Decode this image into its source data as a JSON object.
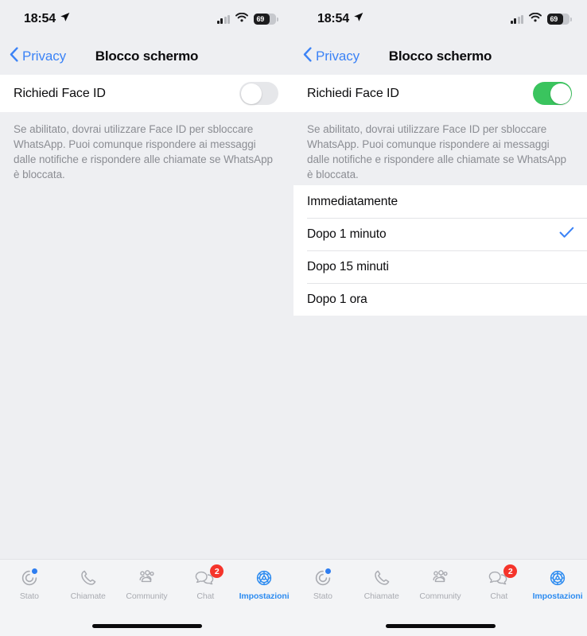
{
  "meta": {
    "app": "WhatsApp",
    "platform": "iOS",
    "accent_blue": "#3c83f6",
    "accent_green": "#3ac45e",
    "badge_red": "#f5342b",
    "background_gray": "#eeeff2",
    "card_white": "#ffffff",
    "muted_text": "#8b8d93"
  },
  "status_bar": {
    "time": "18:54",
    "location_icon": "location-arrow-icon",
    "cellular_icon": "cellular-bars-icon",
    "wifi_icon": "wifi-icon",
    "battery_icon": "battery-icon",
    "battery_percent": "69"
  },
  "nav": {
    "back_icon": "chevron-left-icon",
    "back_label": "Privacy",
    "title": "Blocco schermo"
  },
  "setting": {
    "label": "Richiedi Face ID",
    "footnote": "Se abilitato, dovrai utilizzare Face ID per sbloccare WhatsApp. Puoi comunque rispondere ai messaggi dalle notifiche e rispondere alle chiamate se WhatsApp è bloccata.",
    "toggle_off_state": "off",
    "toggle_on_state": "on"
  },
  "options": {
    "check_icon": "checkmark-icon",
    "selected": "Dopo 1 minuto",
    "items": [
      {
        "label": "Immediatamente",
        "selected": false
      },
      {
        "label": "Dopo 1 minuto",
        "selected": true
      },
      {
        "label": "Dopo 15 minuti",
        "selected": false
      },
      {
        "label": "Dopo 1 ora",
        "selected": false
      }
    ]
  },
  "tab_bar": {
    "items": [
      {
        "label": "Stato",
        "icon": "status-rings-icon",
        "badge": "",
        "dot": true,
        "active": false
      },
      {
        "label": "Chiamate",
        "icon": "phone-icon",
        "badge": "",
        "dot": false,
        "active": false
      },
      {
        "label": "Community",
        "icon": "community-icon",
        "badge": "",
        "dot": false,
        "active": false
      },
      {
        "label": "Chat",
        "icon": "chat-bubbles-icon",
        "badge": "2",
        "dot": false,
        "active": false
      },
      {
        "label": "Impostazioni",
        "icon": "gear-icon",
        "badge": "",
        "dot": false,
        "active": true
      }
    ]
  },
  "home_indicator": "home-indicator"
}
